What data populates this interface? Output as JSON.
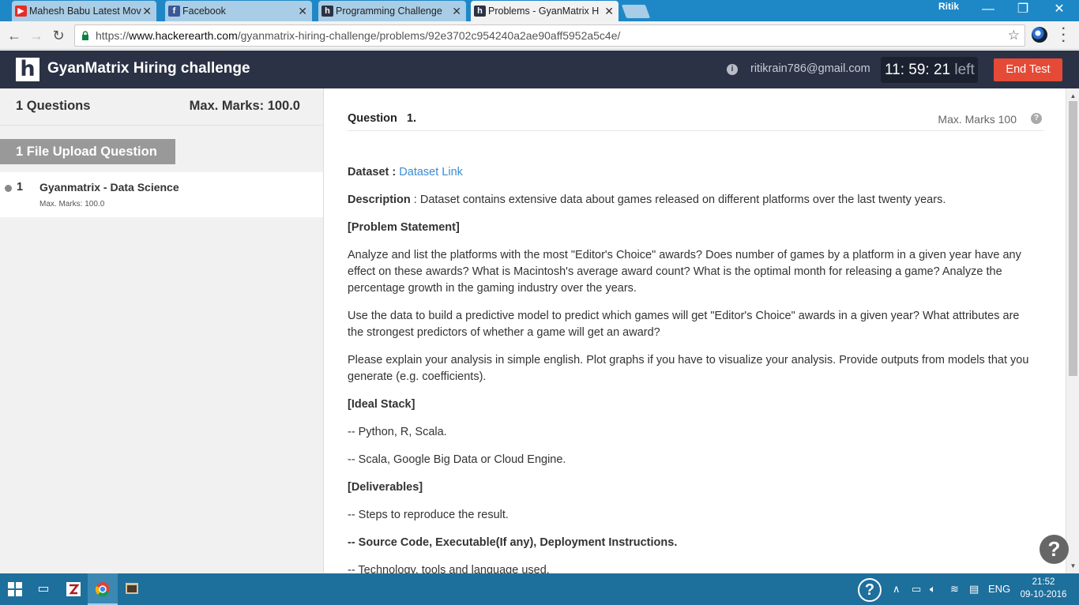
{
  "browser": {
    "tabs": [
      {
        "title": "Mahesh Babu Latest Mov",
        "icon": "youtube-icon",
        "color": "#e52d27"
      },
      {
        "title": "Facebook",
        "icon": "facebook-icon",
        "color": "#3b5998"
      },
      {
        "title": "Programming Challenge",
        "icon": "hackerearth-icon",
        "color": "#2b3245"
      },
      {
        "title": "Problems - GyanMatrix H",
        "icon": "hackerearth-icon",
        "color": "#2b3245"
      }
    ],
    "profile_name": "Ritik",
    "url_scheme": "https://",
    "url_host": "www.hackerearth.com",
    "url_path": "/gyanmatrix-hiring-challenge/problems/92e3702c954240a2ae90aff5952a5c4e/"
  },
  "header": {
    "logo": "h",
    "title": "GyanMatrix Hiring challenge",
    "email": "ritikrain786@gmail.com",
    "timer": "11: 59: 21",
    "timer_suffix": "left",
    "end_test_label": "End Test"
  },
  "sidebar": {
    "questions_count": "1 Questions",
    "max_marks": "Max. Marks: 100.0",
    "section_label": "1 File Upload Question",
    "items": [
      {
        "number": "1",
        "name": "Gyanmatrix - Data Science",
        "marks": "Max. Marks: 100.0"
      }
    ]
  },
  "question": {
    "label": "Question",
    "number": "1.",
    "max_marks": "Max. Marks 100",
    "dataset_label": "Dataset :",
    "dataset_link": "Dataset Link",
    "description_label": "Description",
    "description_text": ": Dataset contains extensive data about games released on different platforms over the last twenty years.",
    "problem_heading": "[Problem Statement]",
    "para1": "Analyze and list the platforms with the most \"Editor's Choice\" awards? Does number of games by a platform in a given year have any effect on these awards? What is Macintosh's average award count? What is the optimal month for releasing a game? Analyze the percentage growth in the gaming industry over the years.",
    "para2": "Use the data to build a predictive model to predict which games will get \"Editor's Choice\" awards in a given year? What attributes are the strongest predictors of whether a game will get an award?",
    "para3": "Please explain your analysis in simple english. Plot graphs if you have to visualize your analysis. Provide outputs from models that you generate (e.g. coefficients).",
    "stack_heading": "[Ideal Stack]",
    "stack1": "-- Python, R, Scala.",
    "stack2": "-- Scala, Google Big Data or Cloud Engine.",
    "deliverables_heading": "[Deliverables]",
    "deliv1": "-- Steps to reproduce the result.",
    "deliv2": "-- Source Code, Executable(If any), Deployment Instructions.",
    "deliv3": "-- Technology, tools and language used."
  },
  "taskbar": {
    "language": "ENG",
    "time": "21:52",
    "date": "09-10-2016"
  },
  "colors": {
    "header_bg": "#2b3245",
    "end_test": "#e44a36",
    "link": "#3a8bd1",
    "taskbar": "#1d6f9c"
  }
}
